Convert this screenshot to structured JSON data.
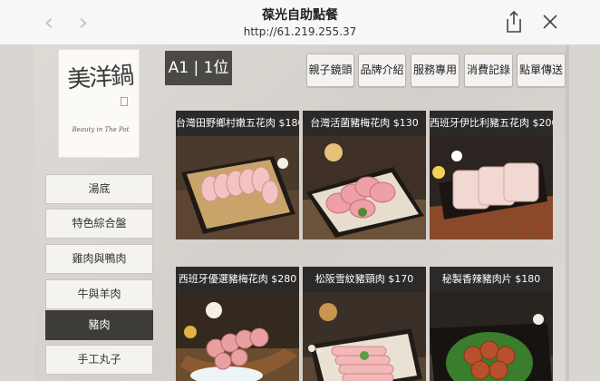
{
  "browser": {
    "title": "葆光自助點餐",
    "url": "http://61.219.255.37",
    "back_glyph": "‹",
    "forward_glyph": "›"
  },
  "logo": {
    "text": "美洋鍋",
    "tagline": "Beauty in The Pot"
  },
  "table": {
    "label": "A1 | 1位"
  },
  "top_buttons": [
    {
      "label": "親子鏡頭"
    },
    {
      "label": "品牌介紹"
    },
    {
      "label": "服務專用"
    },
    {
      "label": "消費記錄"
    },
    {
      "label": "點單傳送"
    }
  ],
  "categories": [
    {
      "label": "湯底",
      "active": false
    },
    {
      "label": "特色綜合盤",
      "active": false
    },
    {
      "label": "雞肉與鴨肉",
      "active": false
    },
    {
      "label": "牛與羊肉",
      "active": false
    },
    {
      "label": "豬肉",
      "active": true
    },
    {
      "label": "手工丸子",
      "active": false
    }
  ],
  "products": [
    {
      "label": "台灣田野鄉村嫩五花肉 $180",
      "icon": "pork-belly-rolls-photo"
    },
    {
      "label": "台灣活菌豬梅花肉 $130",
      "icon": "pork-shoulder-photo"
    },
    {
      "label": "西班牙伊比利豬五花肉 $200",
      "icon": "iberico-pork-photo"
    },
    {
      "label": "西班牙優選豬梅花肉 $280",
      "icon": "pork-boat-photo"
    },
    {
      "label": "松阪雪紋豬頸肉 $170",
      "icon": "pork-jowl-photo"
    },
    {
      "label": "秘製香辣豬肉片 $180",
      "icon": "spicy-pork-photo"
    }
  ],
  "colors": {
    "active_category": "#3e3c39",
    "badge": "#4b4945",
    "meat": "#e9a9a8"
  }
}
